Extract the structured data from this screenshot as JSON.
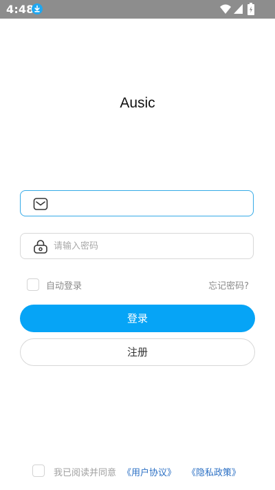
{
  "status_bar": {
    "time": "4:48",
    "icons": [
      "download-icon",
      "wifi-icon",
      "signal-icon",
      "battery-icon"
    ]
  },
  "app": {
    "title": "Ausic"
  },
  "form": {
    "email": {
      "value": "",
      "placeholder": "",
      "icon": "mail-icon"
    },
    "password": {
      "value": "",
      "placeholder": "请输入密码",
      "icon": "lock-icon"
    },
    "remember_label": "自动登录",
    "forgot_label": "忘记密码?",
    "login_label": "登录",
    "register_label": "注册"
  },
  "agreement": {
    "prefix": "我已阅读并同意",
    "user_agreement": "《用户协议》",
    "privacy_policy": "《隐私政策》"
  },
  "colors": {
    "status_bar": "#8d8d8d",
    "primary": "#06a4f6",
    "focus_border": "#33a9e6",
    "link": "#2a6fc4"
  }
}
